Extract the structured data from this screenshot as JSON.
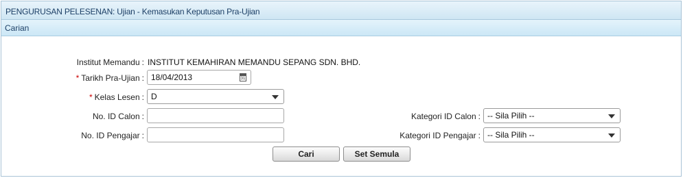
{
  "header": {
    "title": "PENGURUSAN PELESENAN: Ujian - Kemasukan Keputusan Pra-Ujian"
  },
  "section": {
    "title": "Carian"
  },
  "form": {
    "institut": {
      "label": "Institut Memandu",
      "value": "INSTITUT KEMAHIRAN MEMANDU SEPANG SDN. BHD."
    },
    "tarikh": {
      "required_mark": "*",
      "label": "Tarikh Pra-Ujian",
      "value": "18/04/2013",
      "icon_day": "31"
    },
    "kelas": {
      "required_mark": "*",
      "label": "Kelas Lesen",
      "value": "D"
    },
    "no_id_calon": {
      "label": "No. ID Calon",
      "value": ""
    },
    "no_id_pengajar": {
      "label": "No. ID Pengajar",
      "value": ""
    },
    "kategori_calon": {
      "label": "Kategori ID Calon",
      "value": "-- Sila Pilih --"
    },
    "kategori_pengajar": {
      "label": "Kategori ID Pengajar",
      "value": "-- Sila Pilih --"
    },
    "colon": ":"
  },
  "buttons": {
    "search": "Cari",
    "reset": "Set Semula"
  },
  "icons": {
    "calendar": "calendar-icon",
    "dropdown": "chevron-down-icon"
  },
  "colors": {
    "required": "#cc0000",
    "header_text": "#1c3f66",
    "border": "#a9c3d6"
  }
}
